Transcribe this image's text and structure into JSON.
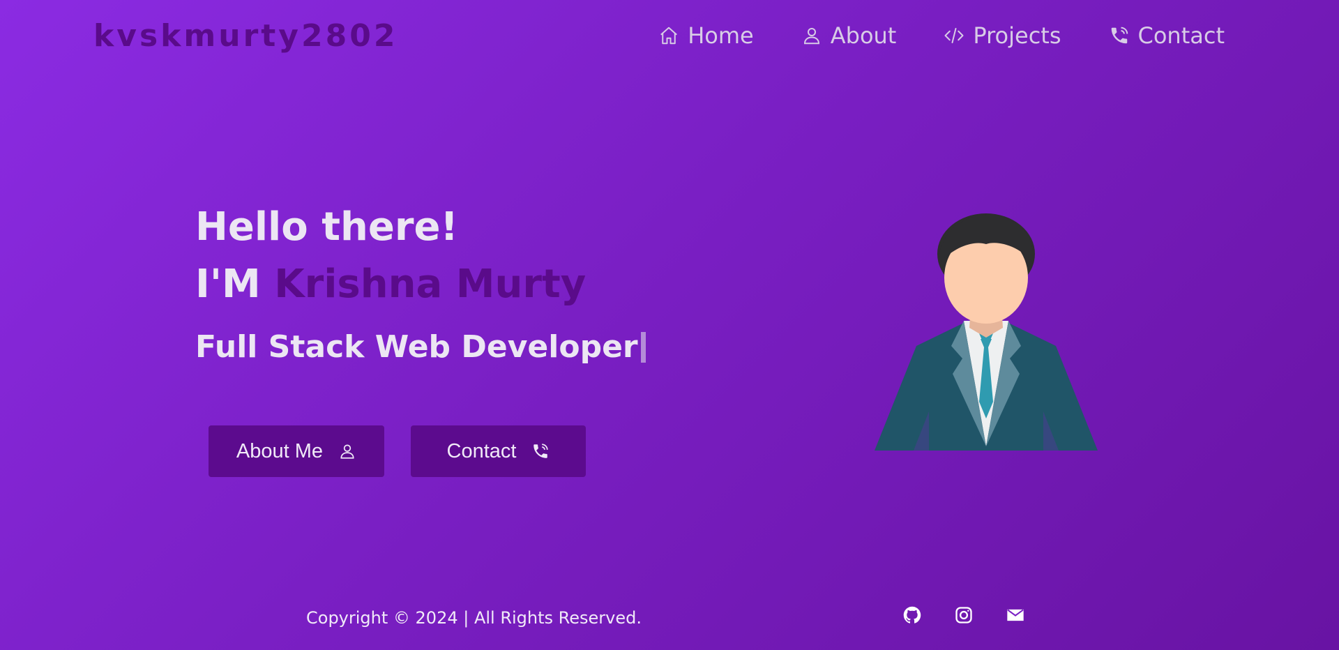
{
  "brand": {
    "logo": "kvskmurty2802"
  },
  "nav": {
    "items": [
      {
        "label": "Home",
        "icon": "home-icon"
      },
      {
        "label": "About",
        "icon": "user-icon"
      },
      {
        "label": "Projects",
        "icon": "code-icon"
      },
      {
        "label": "Contact",
        "icon": "phone-icon"
      }
    ]
  },
  "hero": {
    "greeting": "Hello there!",
    "intro_prefix": "I'M",
    "name": "Krishna Murty",
    "role": "Full Stack Web Developer",
    "buttons": {
      "about_label": "About Me",
      "contact_label": "Contact"
    },
    "avatar_icon": "developer-avatar"
  },
  "footer": {
    "copyright": "Copyright © 2024 | All Rights Reserved.",
    "socials": [
      "github-icon",
      "instagram-icon",
      "mail-icon"
    ]
  },
  "colors": {
    "background_start": "#8b2be2",
    "background_end": "#6813a3",
    "accent": "#5a0b8a",
    "button": "#5c0b8e",
    "text": "#ece6f3"
  }
}
